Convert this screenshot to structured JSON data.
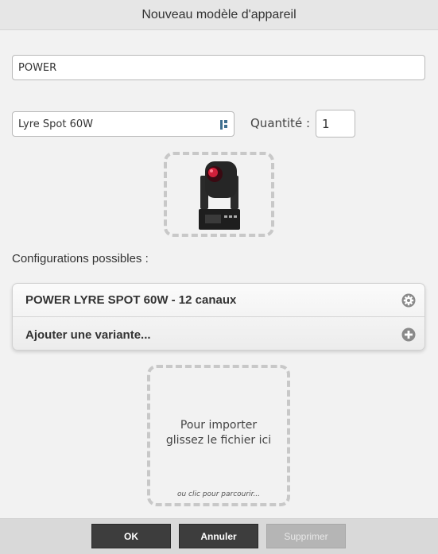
{
  "dialog": {
    "title": "Nouveau modèle d'appareil"
  },
  "form": {
    "name_value": "POWER",
    "model_value": "Lyre Spot 60W",
    "quantity_label": "Quantité :",
    "quantity_value": "1"
  },
  "configurations": {
    "label": "Configurations possibles :",
    "items": [
      {
        "label": "POWER LYRE SPOT 60W - 12 canaux",
        "icon": "gear-icon"
      },
      {
        "label": "Ajouter une variante...",
        "icon": "plus-icon"
      }
    ]
  },
  "file_drop": {
    "line1": "Pour importer",
    "line2": "glissez le fichier ici",
    "browse": "ou clic pour parcourir..."
  },
  "buttons": {
    "ok": "OK",
    "cancel": "Annuler",
    "delete": "Supprimer"
  },
  "colors": {
    "accent_icon": "#3f6f8f",
    "button_dark": "#3d3d3d",
    "button_disabled": "#b5b5b5"
  }
}
